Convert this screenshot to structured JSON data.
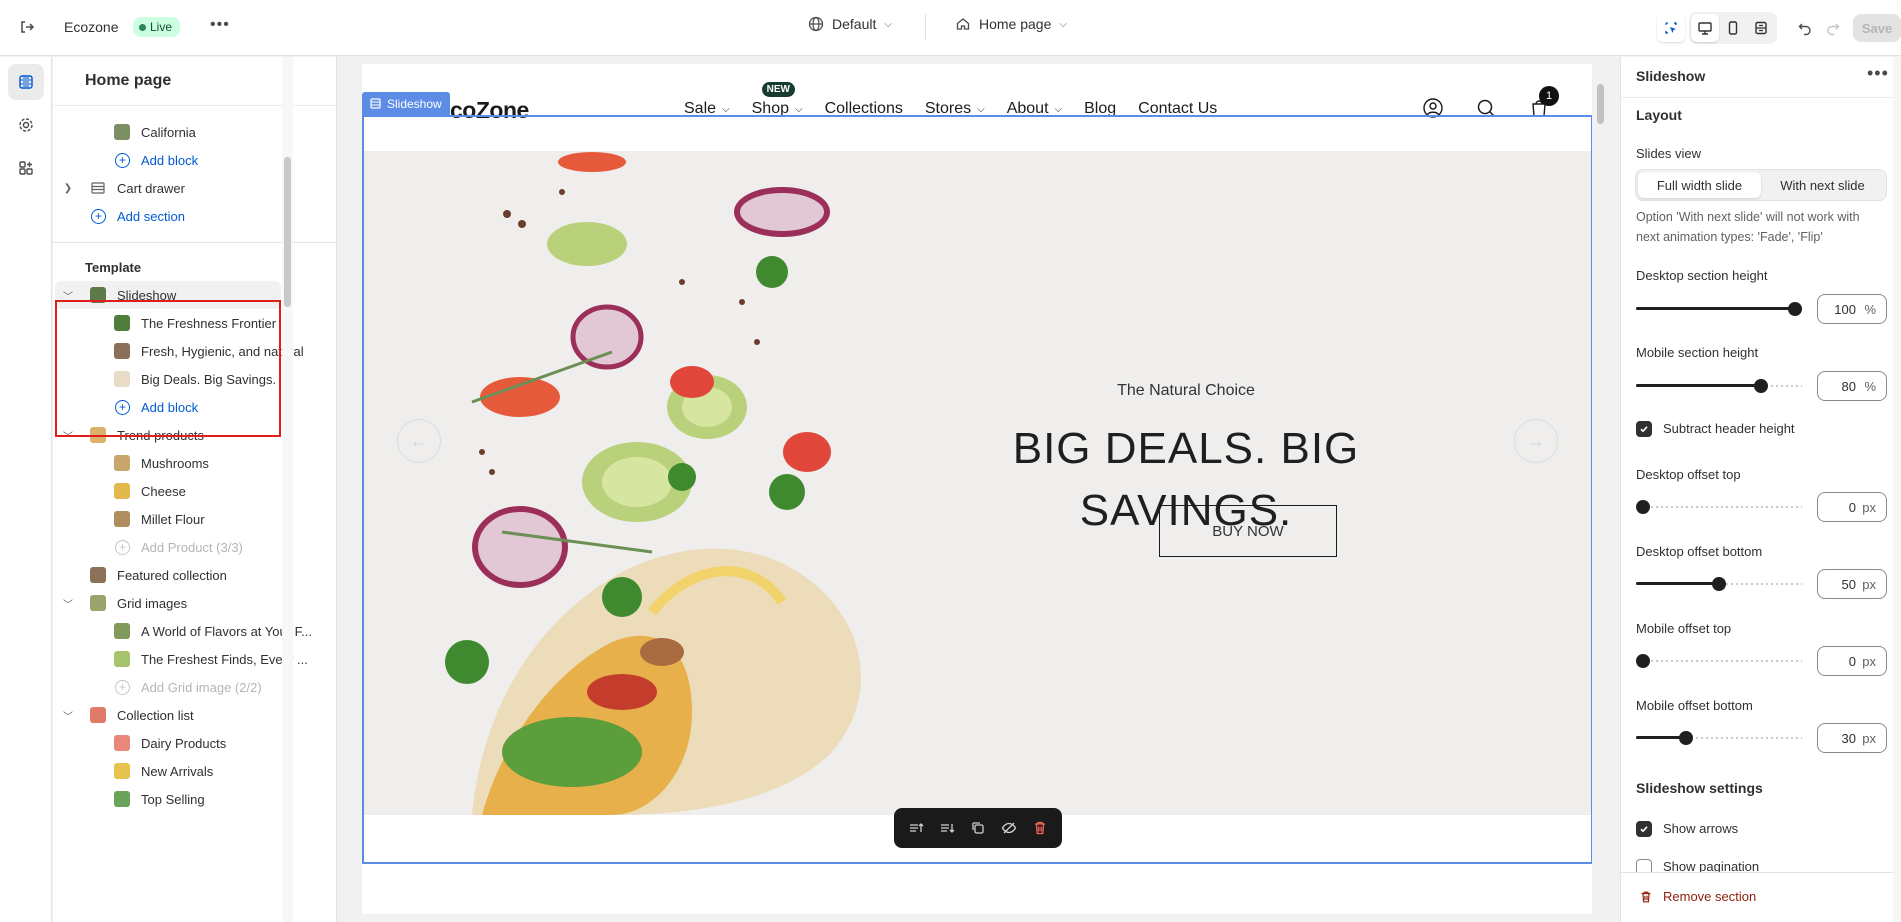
{
  "topbar": {
    "app_name": "Ecozone",
    "live_label": "Live",
    "theme_selector": "Default",
    "page_selector": "Home page",
    "save_label": "Save"
  },
  "sidebar": {
    "title": "Home page",
    "rows": [
      {
        "label": "California",
        "kind": "block",
        "color": "#7a8f62"
      },
      {
        "label": "Add block",
        "kind": "add"
      },
      {
        "label": "Cart drawer",
        "kind": "section"
      },
      {
        "label": "Add section",
        "kind": "add-section"
      },
      {
        "label": "Template",
        "kind": "heading"
      },
      {
        "label": "Slideshow",
        "kind": "section-selected"
      },
      {
        "label": "The Freshness Frontier",
        "kind": "block"
      },
      {
        "label": "Fresh, Hygienic, and natural",
        "kind": "block"
      },
      {
        "label": "Big Deals. Big Savings.",
        "kind": "block"
      },
      {
        "label": "Add block",
        "kind": "add"
      },
      {
        "label": "Trend products",
        "kind": "section"
      },
      {
        "label": "Mushrooms",
        "kind": "block"
      },
      {
        "label": "Cheese",
        "kind": "block"
      },
      {
        "label": "Millet Flour",
        "kind": "block"
      },
      {
        "label": "Add Product (3/3)",
        "kind": "add-disabled"
      },
      {
        "label": "Featured collection",
        "kind": "section"
      },
      {
        "label": "Grid images",
        "kind": "section"
      },
      {
        "label": "A World of Flavors at Your F...",
        "kind": "block"
      },
      {
        "label": "The Freshest Finds, Every ...",
        "kind": "block"
      },
      {
        "label": "Add Grid image (2/2)",
        "kind": "add-disabled"
      },
      {
        "label": "Collection list",
        "kind": "section"
      },
      {
        "label": "Dairy Products",
        "kind": "block"
      },
      {
        "label": "New Arrivals",
        "kind": "block"
      },
      {
        "label": "Top Selling",
        "kind": "block"
      }
    ]
  },
  "preview": {
    "section_tag": "Slideshow",
    "logo": "coZone",
    "nav": [
      {
        "label": "Sale",
        "dropdown": true
      },
      {
        "label": "Shop",
        "dropdown": true,
        "badge": "NEW"
      },
      {
        "label": "Collections",
        "dropdown": false
      },
      {
        "label": "Stores",
        "dropdown": true
      },
      {
        "label": "About",
        "dropdown": true
      },
      {
        "label": "Blog",
        "dropdown": false
      },
      {
        "label": "Contact Us",
        "dropdown": false
      }
    ],
    "cart_count": "1",
    "hero": {
      "subheading": "The Natural Choice",
      "heading_line1": "BIG DEALS. BIG",
      "heading_line2": "SAVINGS.",
      "button": "BUY NOW"
    }
  },
  "settings": {
    "title": "Slideshow",
    "layout_heading": "Layout",
    "slides_view_label": "Slides view",
    "slides_view_options": [
      "Full width slide",
      "With next slide"
    ],
    "slides_view_selected": "Full width slide",
    "slides_view_help": "Option 'With next slide' will not work with next animation types: 'Fade', 'Flip'",
    "desktop_height": {
      "label": "Desktop section height",
      "value": "100",
      "unit": "%",
      "fraction": 1.0
    },
    "mobile_height": {
      "label": "Mobile section height",
      "value": "80",
      "unit": "%",
      "fraction": 0.75
    },
    "subtract_header": {
      "label": "Subtract header height",
      "checked": true
    },
    "desktop_offset_top": {
      "label": "Desktop offset top",
      "value": "0",
      "unit": "px",
      "fraction": 0.0
    },
    "desktop_offset_bottom": {
      "label": "Desktop offset bottom",
      "value": "50",
      "unit": "px",
      "fraction": 0.5
    },
    "mobile_offset_top": {
      "label": "Mobile offset top",
      "value": "0",
      "unit": "px",
      "fraction": 0.0
    },
    "mobile_offset_bottom": {
      "label": "Mobile offset bottom",
      "value": "30",
      "unit": "px",
      "fraction": 0.3
    },
    "slideshow_settings_heading": "Slideshow settings",
    "show_arrows": {
      "label": "Show arrows",
      "checked": true
    },
    "show_pagination": {
      "label": "Show pagination",
      "checked": false
    },
    "remove_label": "Remove section"
  }
}
